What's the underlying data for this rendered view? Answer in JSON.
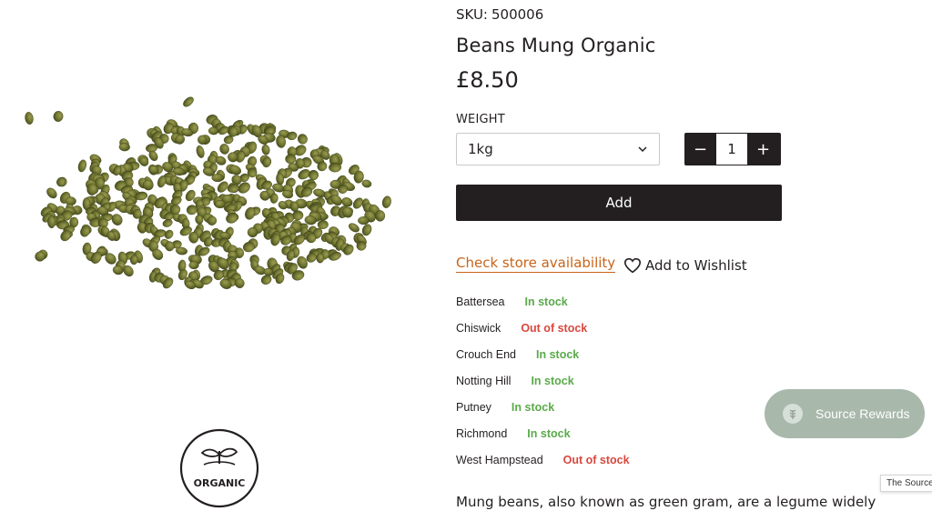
{
  "product": {
    "sku_label": "SKU:",
    "sku_value": "500006",
    "title": "Beans Mung Organic",
    "price": "£8.50",
    "image_icon": "mung-beans-pile-image",
    "badge_icon": "organic-seedling-icon",
    "badge_text": "ORGANIC"
  },
  "options": {
    "weight_label": "WEIGHT",
    "weight_selected": "1kg",
    "quantity": "1",
    "minus_glyph": "−",
    "plus_glyph": "+"
  },
  "actions": {
    "add_label": "Add",
    "check_store_label": "Check store availability",
    "wishlist_label": "Add to Wishlist"
  },
  "stores": [
    {
      "name": "Battersea",
      "status": "In stock",
      "in_stock": true
    },
    {
      "name": "Chiswick",
      "status": "Out of stock",
      "in_stock": false
    },
    {
      "name": "Crouch End",
      "status": "In stock",
      "in_stock": true
    },
    {
      "name": "Notting Hill",
      "status": "In stock",
      "in_stock": true
    },
    {
      "name": "Putney",
      "status": "In stock",
      "in_stock": true
    },
    {
      "name": "Richmond",
      "status": "In stock",
      "in_stock": true
    },
    {
      "name": "West Hampstead",
      "status": "Out of stock",
      "in_stock": false
    }
  ],
  "description": "Mung beans, also known as green gram, are a legume widely",
  "rewards": {
    "label": "Source Rewards"
  },
  "source_tag": "The Source",
  "colors": {
    "primary": "#231f20",
    "accent_link": "#c8641a",
    "in_stock": "#5aaa4a",
    "out_of_stock": "#d9473e",
    "rewards_bg": "#a8b8ab"
  }
}
